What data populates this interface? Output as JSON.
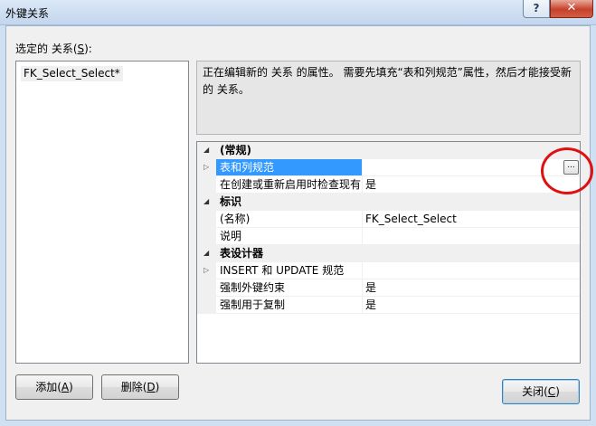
{
  "window": {
    "title": "外键关系",
    "help_glyph": "?",
    "close_glyph": "✕"
  },
  "selected_label": {
    "text": "选定的 关系(",
    "hotkey": "S",
    "suffix": "):"
  },
  "relationships": [
    "FK_Select_Select*"
  ],
  "description": "正在编辑新的 关系 的属性。 需要先填充“表和列规范”属性，然后才能接受新的 关系。",
  "properties": [
    {
      "type": "category",
      "label": "(常规)"
    },
    {
      "type": "prop",
      "label": "表和列规范",
      "value": "",
      "expandable": true,
      "selected": true,
      "has_ellipsis": true
    },
    {
      "type": "prop",
      "label": "在创建或重新启用时检查现有",
      "value": "是"
    },
    {
      "type": "category",
      "label": "标识"
    },
    {
      "type": "prop",
      "label": "(名称)",
      "value": "FK_Select_Select"
    },
    {
      "type": "prop",
      "label": "说明",
      "value": ""
    },
    {
      "type": "category",
      "label": "表设计器"
    },
    {
      "type": "prop",
      "label": "INSERT 和 UPDATE 规范",
      "value": "",
      "expandable": true
    },
    {
      "type": "prop",
      "label": "强制外键约束",
      "value": "是"
    },
    {
      "type": "prop",
      "label": "强制用于复制",
      "value": "是"
    }
  ],
  "ellipsis_label": "...",
  "buttons": {
    "add": {
      "text": "添加(",
      "hotkey": "A",
      "suffix": ")"
    },
    "delete": {
      "text": "删除(",
      "hotkey": "D",
      "suffix": ")"
    },
    "close": {
      "text": "关闭(",
      "hotkey": "C",
      "suffix": ")"
    }
  },
  "colors": {
    "selection": "#3399ff",
    "annotation": "#e01010"
  }
}
